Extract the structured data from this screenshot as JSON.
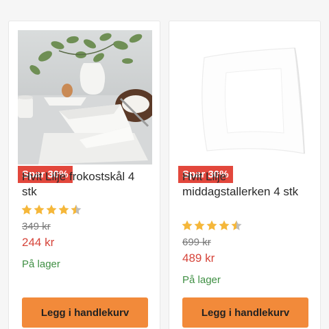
{
  "products": [
    {
      "image_alt": "Hvit Lilje frokostskål product photo",
      "badge": "Spar 30%",
      "title": "Hvit Lilje frokostskål 4 stk",
      "rating": 4.5,
      "rating_max": 5,
      "old_price": "349 kr",
      "price": "244 kr",
      "stock": "På lager",
      "button": "Legg i handlekurv"
    },
    {
      "image_alt": "Hvit Lilje middagstallerken product photo",
      "badge": "Spar 30%",
      "title": "Hvit Lilje middagstallerken 4 stk",
      "rating": 4.5,
      "rating_max": 5,
      "old_price": "699 kr",
      "price": "489 kr",
      "stock": "På lager",
      "button": "Legg i handlekurv"
    }
  ],
  "colors": {
    "badge": "#e2473c",
    "price": "#d6443a",
    "stock": "#3f8f43",
    "button": "#f28a3a",
    "star": "#f5b73a"
  }
}
